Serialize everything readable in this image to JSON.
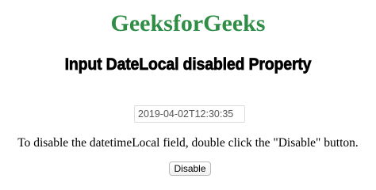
{
  "header": {
    "site_title": "GeeksforGeeks",
    "page_heading": "Input DateLocal disabled Property"
  },
  "datetime_field": {
    "value": "2019-04-02T12:30:35",
    "disabled": true
  },
  "instructions": {
    "text": "To disable the datetimeLocal field, double click the \"Disable\" button."
  },
  "controls": {
    "disable_button_label": "Disable"
  },
  "colors": {
    "site_title": "#2f8d46",
    "text": "#000000",
    "input_text": "#545454",
    "input_border": "#dcdcdc"
  }
}
